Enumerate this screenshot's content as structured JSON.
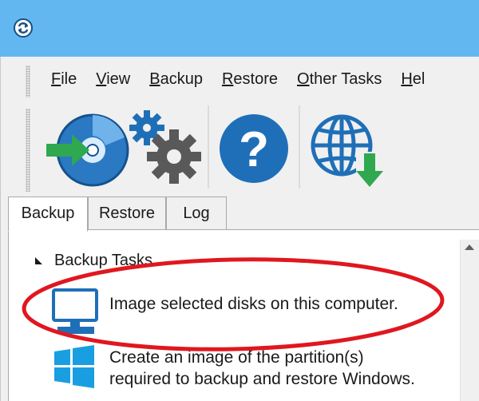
{
  "menu": {
    "items": [
      {
        "key": "F",
        "rest": "ile"
      },
      {
        "key": "V",
        "rest": "iew"
      },
      {
        "key": "B",
        "rest": "ackup"
      },
      {
        "key": "R",
        "rest": "estore"
      },
      {
        "key": "O",
        "rest": "ther Tasks"
      },
      {
        "key": "H",
        "rest": "el"
      }
    ]
  },
  "toolbar": {
    "icons": [
      "disk-backup-icon",
      "settings-gears-icon",
      "help-icon",
      "web-download-icon"
    ]
  },
  "tabs": {
    "items": [
      "Backup",
      "Restore",
      "Log"
    ],
    "active": "Backup"
  },
  "tasks": {
    "section_title": "Backup Tasks",
    "items": [
      {
        "icon": "computer-monitor-icon",
        "text": "Image selected disks on this computer."
      },
      {
        "icon": "windows-logo-icon",
        "line1": "Create an image of the partition(s)",
        "line2": "required to backup and restore Windows."
      }
    ]
  },
  "colors": {
    "titlebar": "#63b7f0",
    "icon_blue": "#1f6fb8",
    "icon_green": "#2fa84f",
    "gear_gray": "#595959",
    "windows_blue": "#1a9ee2",
    "annotation_red": "#e0171f"
  }
}
